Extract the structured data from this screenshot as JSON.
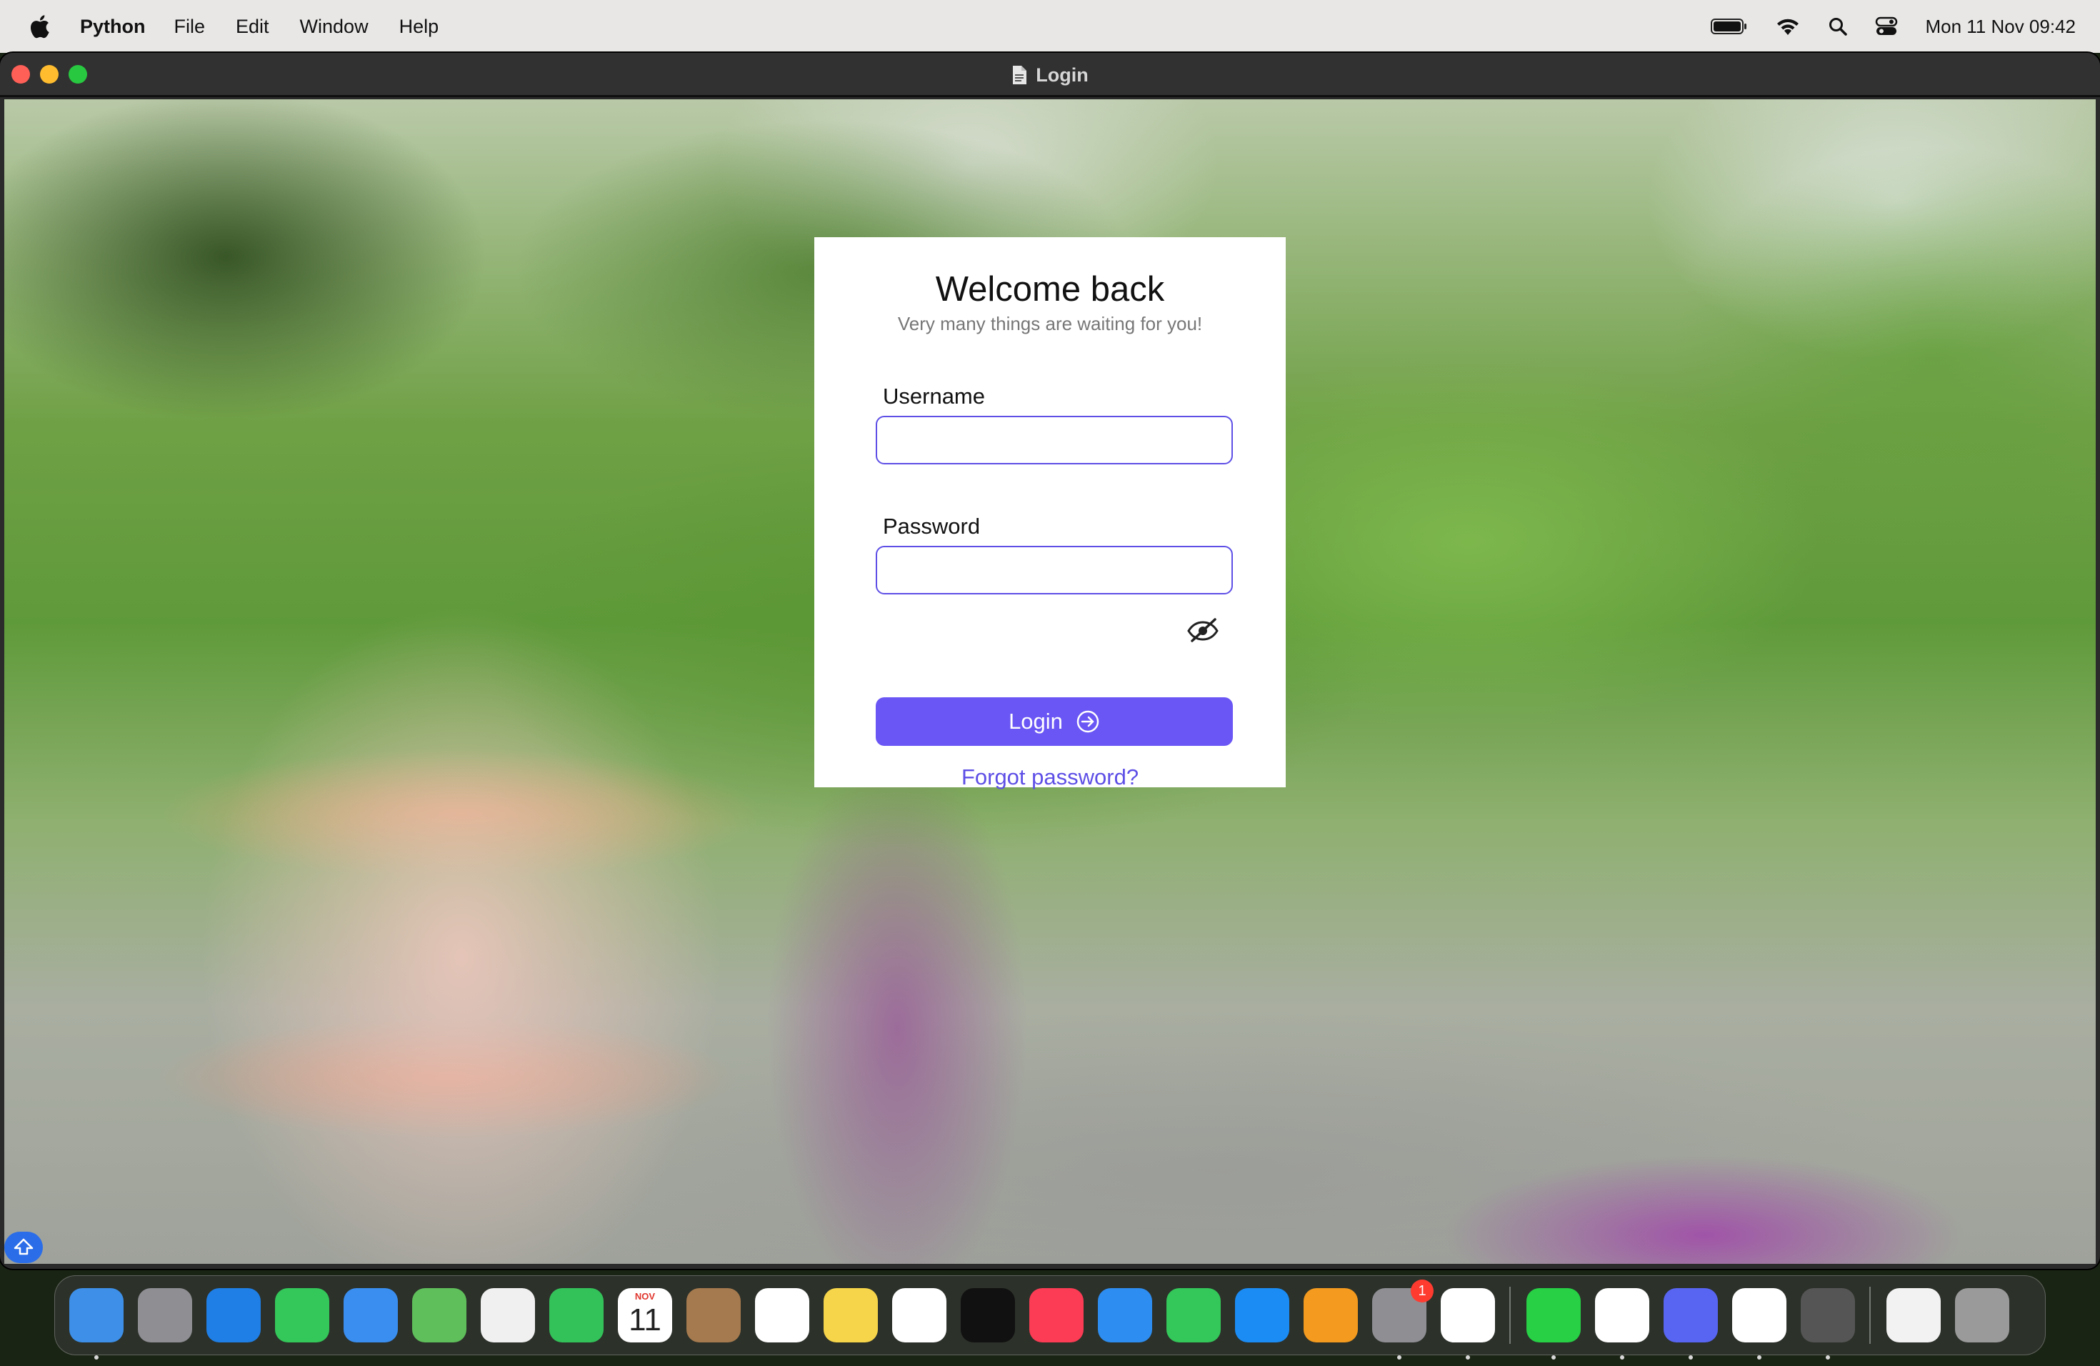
{
  "menubar": {
    "app_name": "Python",
    "items": [
      "File",
      "Edit",
      "Window",
      "Help"
    ],
    "clock": "Mon 11 Nov  09:42"
  },
  "window": {
    "title": "Login"
  },
  "login": {
    "title": "Welcome back",
    "subtitle": "Very many things are waiting for you!",
    "username_label": "Username",
    "username_value": "",
    "password_label": "Password",
    "password_value": "",
    "login_button": "Login",
    "forgot_link": "Forgot password?"
  },
  "dock": {
    "calendar_month": "NOV",
    "calendar_day": "11",
    "settings_badge": "1",
    "apps": [
      {
        "name": "finder-icon",
        "color": "#3d8fe8"
      },
      {
        "name": "launchpad-icon",
        "color": "#8e8e93"
      },
      {
        "name": "safari-icon",
        "color": "#1f7fe6"
      },
      {
        "name": "messages-icon",
        "color": "#34c759"
      },
      {
        "name": "mail-icon",
        "color": "#3a8ef0"
      },
      {
        "name": "maps-icon",
        "color": "#5fbf5a"
      },
      {
        "name": "photos-icon",
        "color": "#f0f0f0"
      },
      {
        "name": "facetime-icon",
        "color": "#33c25a"
      },
      {
        "name": "calendar-icon",
        "color": "#ffffff"
      },
      {
        "name": "contacts-icon",
        "color": "#a57a4e"
      },
      {
        "name": "reminders-icon",
        "color": "#ffffff"
      },
      {
        "name": "notes-icon",
        "color": "#f7d54a"
      },
      {
        "name": "freeform-icon",
        "color": "#ffffff"
      },
      {
        "name": "apple-tv-icon",
        "color": "#111111"
      },
      {
        "name": "music-icon",
        "color": "#fb3c54"
      },
      {
        "name": "keynote-icon",
        "color": "#2e8df0"
      },
      {
        "name": "numbers-icon",
        "color": "#34c759"
      },
      {
        "name": "app-store-icon",
        "color": "#1b8cf4"
      },
      {
        "name": "pages-icon",
        "color": "#f49a1e"
      },
      {
        "name": "system-settings-icon",
        "color": "#8e8e93"
      },
      {
        "name": "chrome-icon",
        "color": "#ffffff"
      },
      {
        "name": "whatsapp-icon",
        "color": "#27d045"
      },
      {
        "name": "vscode-icon",
        "color": "#ffffff"
      },
      {
        "name": "discord-icon",
        "color": "#5865f2"
      },
      {
        "name": "powerpoint-icon",
        "color": "#ffffff"
      },
      {
        "name": "rocket-icon",
        "color": "#555555"
      },
      {
        "name": "document-icon",
        "color": "#f2f2f2"
      },
      {
        "name": "trash-icon",
        "color": "#9a9a9a"
      }
    ]
  }
}
